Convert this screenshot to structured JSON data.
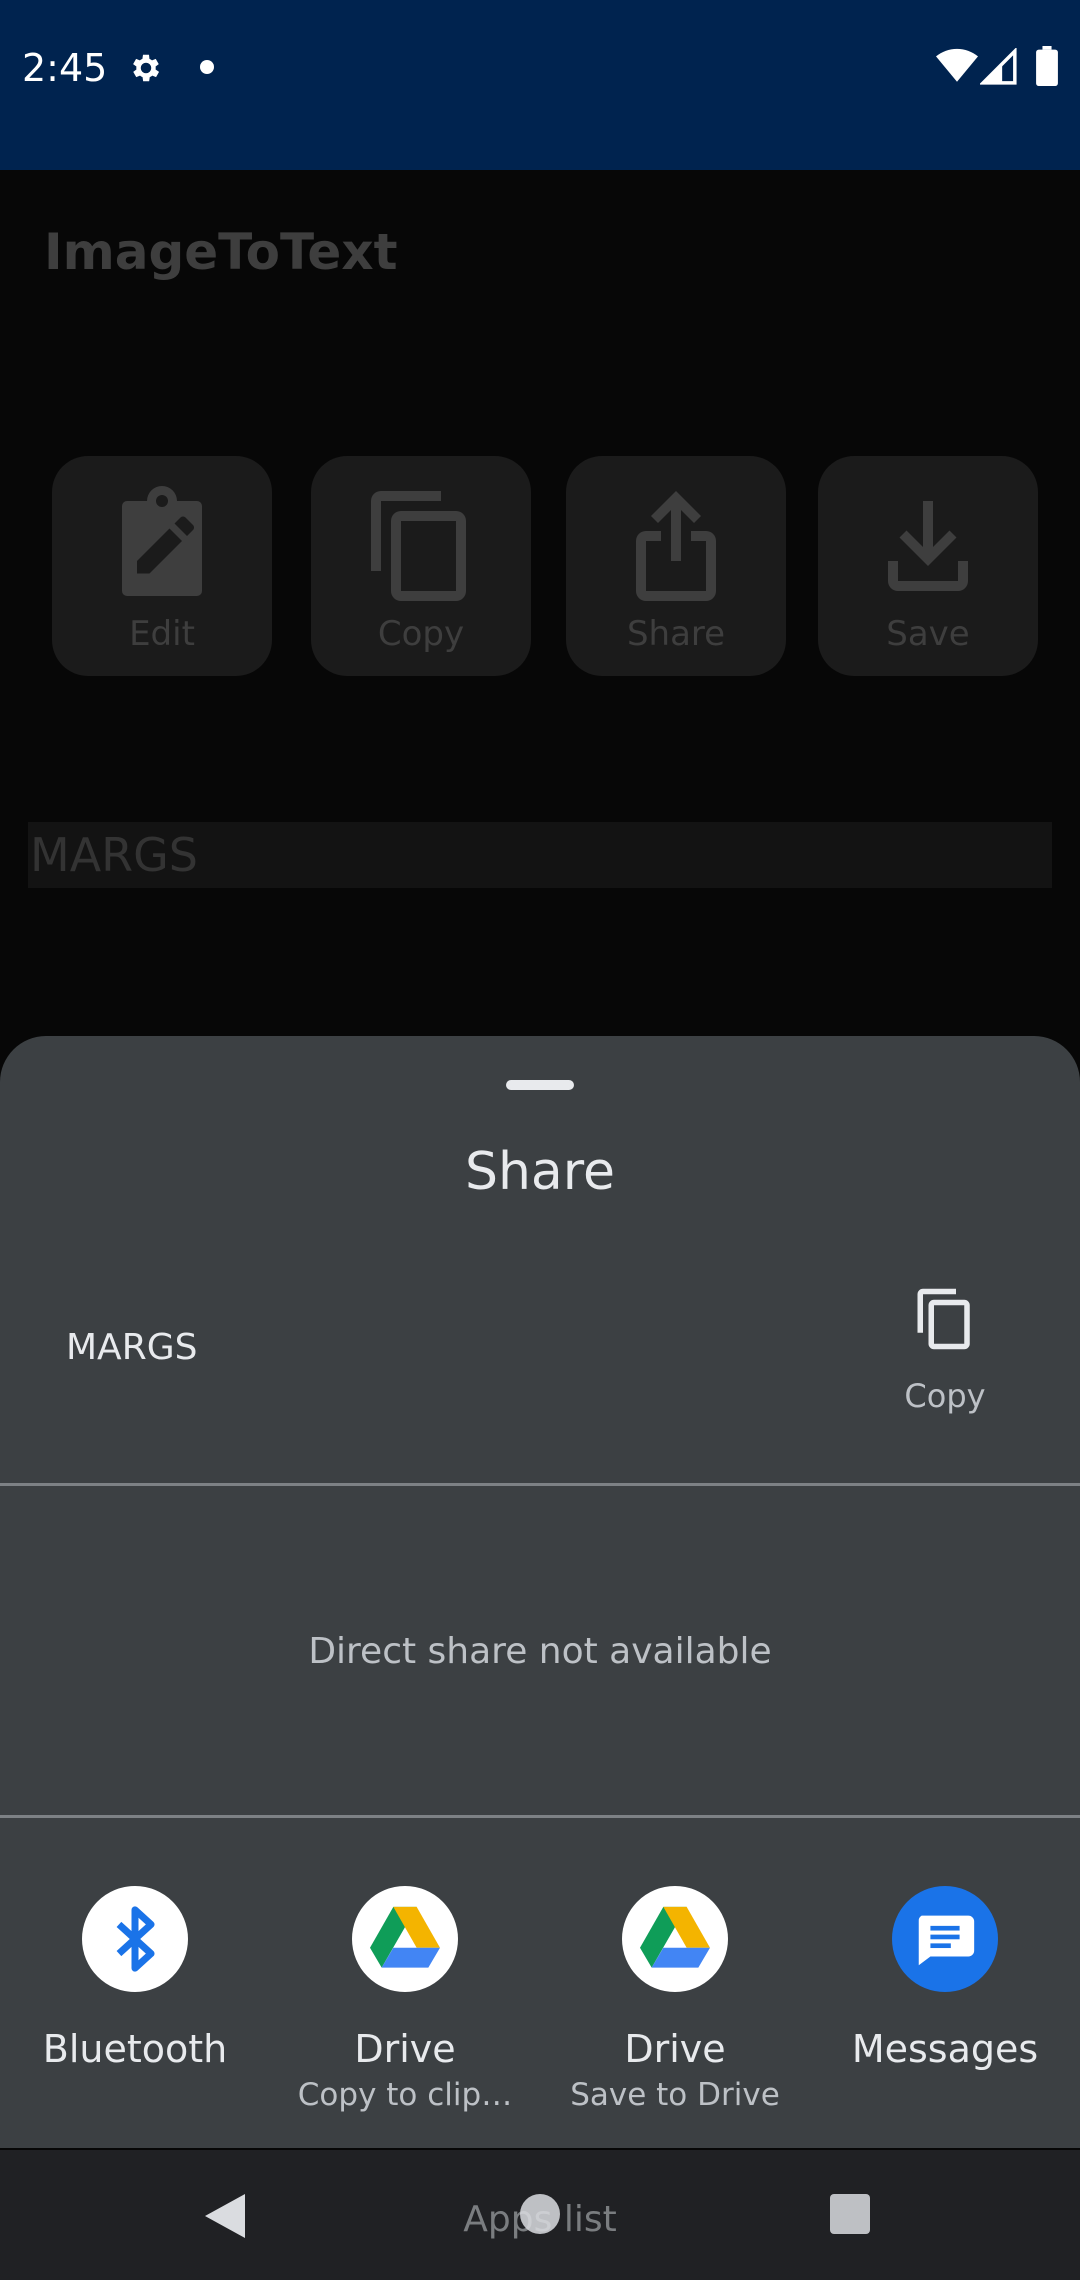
{
  "status_bar": {
    "time": "2:45",
    "icons": [
      "gear-icon",
      "notification-dot-icon",
      "wifi-icon",
      "cell-signal-icon",
      "battery-icon"
    ]
  },
  "app": {
    "title": "ImageToText",
    "actions": [
      {
        "label": "Edit",
        "icon": "edit-clipboard-icon"
      },
      {
        "label": "Copy",
        "icon": "copy-icon"
      },
      {
        "label": "Share",
        "icon": "share-icon"
      },
      {
        "label": "Save",
        "icon": "download-icon"
      }
    ],
    "recognized_text": "MARGS"
  },
  "share_sheet": {
    "title": "Share",
    "preview_text": "MARGS",
    "copy_label": "Copy",
    "direct_share_message": "Direct share not available",
    "targets": [
      {
        "name": "Bluetooth",
        "sub": "",
        "icon": "bluetooth-icon"
      },
      {
        "name": "Drive",
        "sub": "Copy to clip…",
        "icon": "google-drive-icon"
      },
      {
        "name": "Drive",
        "sub": "Save to Drive",
        "icon": "google-drive-icon"
      },
      {
        "name": "Messages",
        "sub": "",
        "icon": "messages-icon"
      }
    ]
  },
  "nav_bar": {
    "label": "Apps list"
  },
  "colors": {
    "status_bar": "#00234f",
    "sheet": "#3c4043",
    "messages_blue": "#1a73e8",
    "bluetooth_blue": "#1a73e8"
  }
}
